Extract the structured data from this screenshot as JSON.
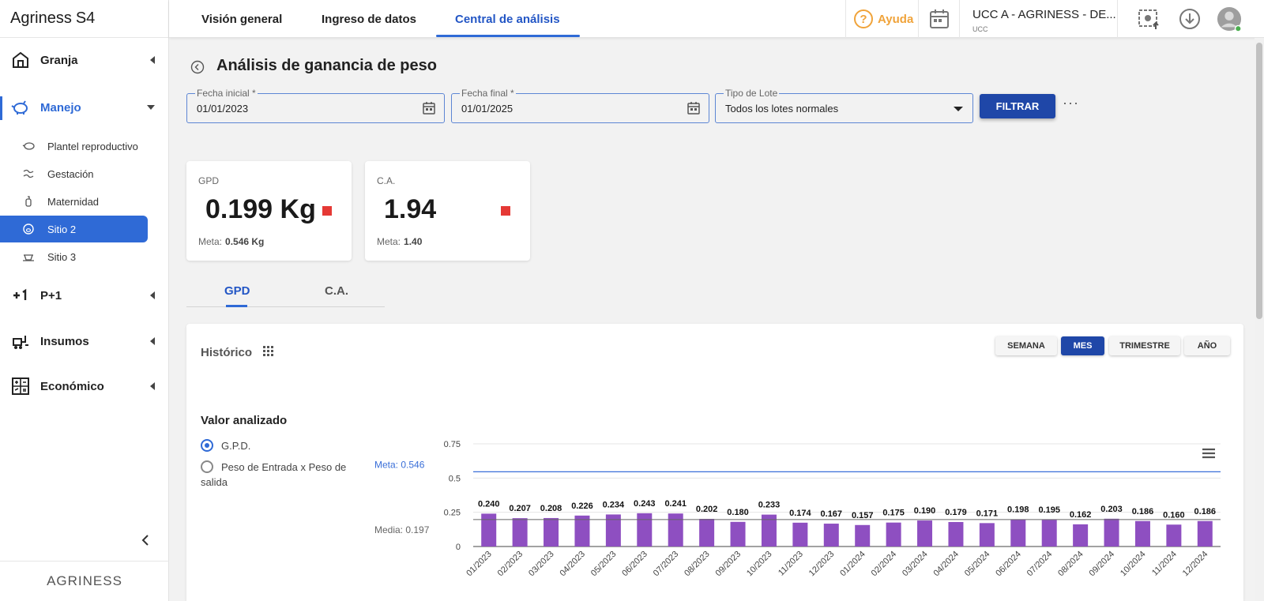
{
  "app": {
    "brand": "Agriness",
    "brand_suffix": "S4",
    "footer_logo": "AGRINESS"
  },
  "sidebar": {
    "groups": [
      {
        "label": "Granja",
        "icon": "barn-icon"
      },
      {
        "label": "Manejo",
        "icon": "piggy-icon"
      },
      {
        "label": "P+1",
        "icon": "plus-one-icon"
      },
      {
        "label": "Insumos",
        "icon": "forklift-icon"
      },
      {
        "label": "Económico",
        "icon": "calculator-icon"
      }
    ],
    "manejo_items": [
      {
        "label": "Plantel reproductivo"
      },
      {
        "label": "Gestación"
      },
      {
        "label": "Maternidad"
      },
      {
        "label": "Sitio 2"
      },
      {
        "label": "Sitio 3"
      }
    ]
  },
  "topbar": {
    "tabs": [
      "Visión general",
      "Ingreso de datos",
      "Central de análisis"
    ],
    "help": "Ayuda",
    "help_glyph": "?",
    "farm_name": "UCC A - AGRINESS - DE...",
    "farm_sub": "UCC"
  },
  "page": {
    "title": "Análisis de ganancia de peso",
    "filters": {
      "start_label": "Fecha inicial *",
      "start_value": "01/01/2023",
      "end_label": "Fecha final *",
      "end_value": "01/01/2025",
      "type_label": "Tipo de Lote",
      "type_value": "Todos los lotes normales",
      "button": "FILTRAR",
      "more": "···"
    },
    "kpis": [
      {
        "label": "GPD",
        "value": "0.199 Kg",
        "meta_label": "Meta:",
        "meta_value": "0.546 Kg",
        "status_color": "#e53935"
      },
      {
        "label": "C.A.",
        "value": "1.94",
        "meta_label": "Meta:",
        "meta_value": "1.40",
        "status_color": "#e53935"
      }
    ],
    "subtabs": [
      "GPD",
      "C.A."
    ],
    "card": {
      "title": "Histórico",
      "periods": [
        "SEMANA",
        "MES",
        "TRIMESTRE",
        "AÑO"
      ],
      "active_period": "MES",
      "valor_title": "Valor analizado",
      "options": [
        "G.P.D.",
        "Peso de Entrada x Peso de salida"
      ]
    }
  },
  "chart_data": {
    "type": "bar",
    "categories": [
      "01/2023",
      "02/2023",
      "03/2023",
      "04/2023",
      "05/2023",
      "06/2023",
      "07/2023",
      "08/2023",
      "09/2023",
      "10/2023",
      "11/2023",
      "12/2023",
      "01/2024",
      "02/2024",
      "03/2024",
      "04/2024",
      "05/2024",
      "06/2024",
      "07/2024",
      "08/2024",
      "09/2024",
      "10/2024",
      "11/2024",
      "12/2024"
    ],
    "values": [
      0.24,
      0.207,
      0.208,
      0.226,
      0.234,
      0.243,
      0.241,
      0.202,
      0.18,
      0.233,
      0.174,
      0.167,
      0.157,
      0.175,
      0.19,
      0.179,
      0.171,
      0.198,
      0.195,
      0.162,
      0.203,
      0.186,
      0.16,
      0.186
    ],
    "value_labels": [
      "0.240",
      "0.207",
      "0.208",
      "0.226",
      "0.234",
      "0.243",
      "0.241",
      "0.202",
      "0.180",
      "0.233",
      "0.174",
      "0.167",
      "0.157",
      "0.175",
      "0.190",
      "0.179",
      "0.171",
      "0.198",
      "0.195",
      "0.162",
      "0.203",
      "0.186",
      "0.160",
      "0.186"
    ],
    "yticks": [
      "0",
      "0.25",
      "0.5",
      "0.75"
    ],
    "ylim": [
      0,
      0.75
    ],
    "meta": {
      "label": "Meta",
      "value": 0.546,
      "text": "0.546"
    },
    "media": {
      "label": "Media",
      "value": 0.197,
      "text": "0.197"
    },
    "bar_color": "#8e4fc1",
    "meta_color": "#3a6fd8",
    "grid": true
  }
}
